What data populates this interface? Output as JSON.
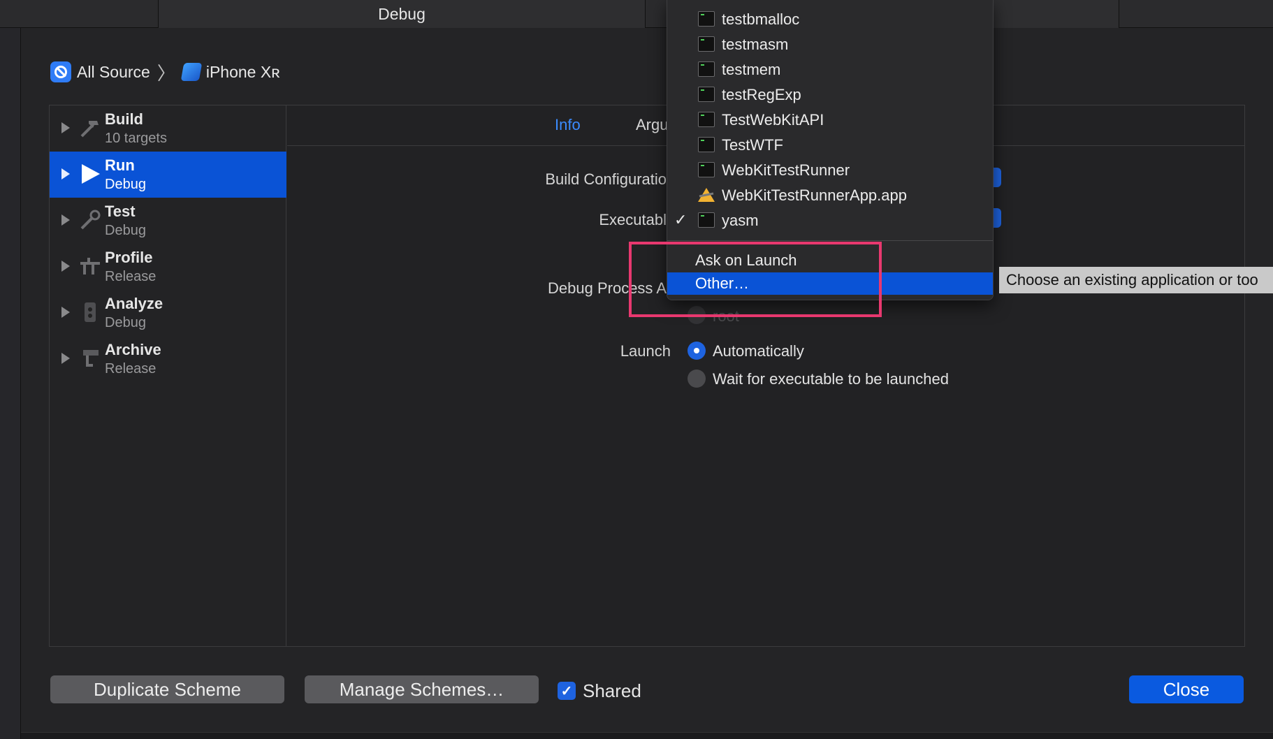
{
  "window": {
    "top_tab_title": "Debug"
  },
  "breadcrumb": {
    "items": [
      {
        "label": "All Source",
        "icon": "app-scheme-icon"
      },
      {
        "label": "iPhone Xʀ",
        "icon": "iphone-device-icon"
      }
    ],
    "separator": "〉"
  },
  "sidebar": {
    "actions": [
      {
        "name": "Build",
        "sub": "10 targets",
        "icon": "hammer-icon",
        "selected": false
      },
      {
        "name": "Run",
        "sub": "Debug",
        "icon": "play-icon",
        "selected": true
      },
      {
        "name": "Test",
        "sub": "Debug",
        "icon": "wrench-icon",
        "selected": false
      },
      {
        "name": "Profile",
        "sub": "Release",
        "icon": "instruments-icon",
        "selected": false
      },
      {
        "name": "Analyze",
        "sub": "Debug",
        "icon": "analyze-icon",
        "selected": false
      },
      {
        "name": "Archive",
        "sub": "Release",
        "icon": "archive-icon",
        "selected": false
      }
    ]
  },
  "tabs": {
    "info": "Info",
    "arguments": "Argu"
  },
  "form": {
    "build_configuration_label": "Build Configuratio",
    "executable_label": "Executabl",
    "debug_process_label": "Debug Process A",
    "launch_label": "Launch",
    "root_option": "root",
    "launch_options": [
      "Automatically",
      "Wait for executable to be launched"
    ]
  },
  "dropdown": {
    "items": [
      {
        "label": "testbmalloc",
        "icon": "terminal-icon",
        "checked": false
      },
      {
        "label": "testmasm",
        "icon": "terminal-icon",
        "checked": false
      },
      {
        "label": "testmem",
        "icon": "terminal-icon",
        "checked": false
      },
      {
        "label": "testRegExp",
        "icon": "terminal-icon",
        "checked": false
      },
      {
        "label": "TestWebKitAPI",
        "icon": "terminal-icon",
        "checked": false
      },
      {
        "label": "TestWTF",
        "icon": "terminal-icon",
        "checked": false
      },
      {
        "label": "WebKitTestRunner",
        "icon": "terminal-icon",
        "checked": false
      },
      {
        "label": "WebKitTestRunnerApp.app",
        "icon": "app-warning-icon",
        "checked": false
      },
      {
        "label": "yasm",
        "icon": "terminal-icon",
        "checked": true
      }
    ],
    "ask_on_launch": "Ask on Launch",
    "other": "Other…",
    "check_mark": "✓",
    "highlight_color": "#e8386f"
  },
  "tooltip": {
    "text": "Choose an existing application or too"
  },
  "footer": {
    "duplicate_label": "Duplicate Scheme",
    "manage_label": "Manage Schemes…",
    "shared_label": "Shared",
    "shared_checked": true,
    "close_label": "Close"
  },
  "colors": {
    "accent": "#0a53d6",
    "link": "#3b8cff"
  }
}
